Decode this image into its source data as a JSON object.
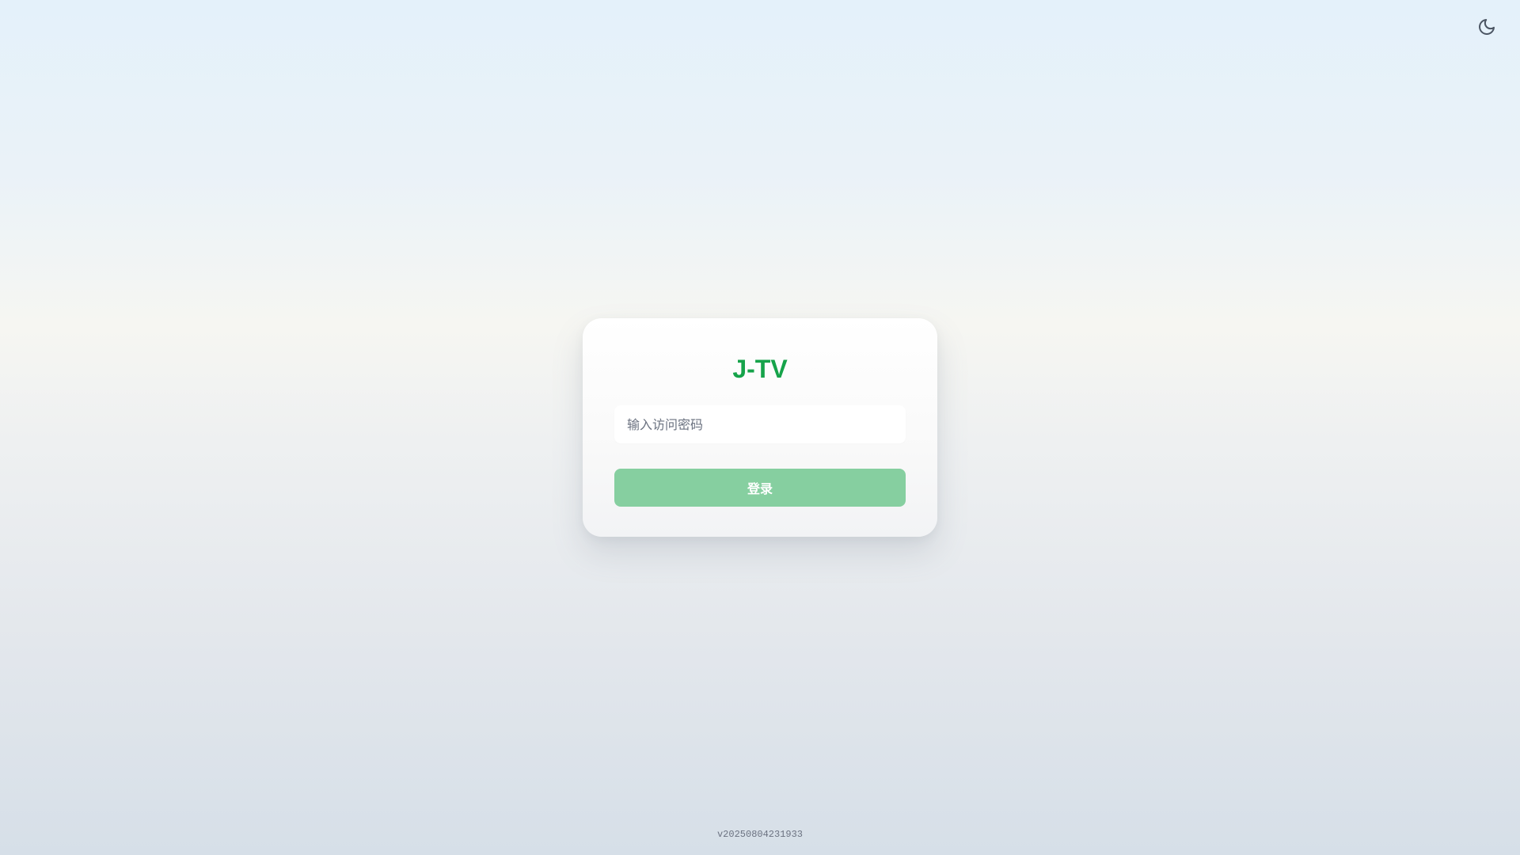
{
  "theme_toggle": {
    "icon": "moon-icon",
    "color": "#4b5563"
  },
  "login_card": {
    "title": "J-TV",
    "title_color": "#16a34a",
    "password_input": {
      "value": "",
      "placeholder": "输入访问密码"
    },
    "login_button": {
      "label": "登录",
      "color": "#86cfa0"
    }
  },
  "footer": {
    "version": "v20250804231933"
  }
}
